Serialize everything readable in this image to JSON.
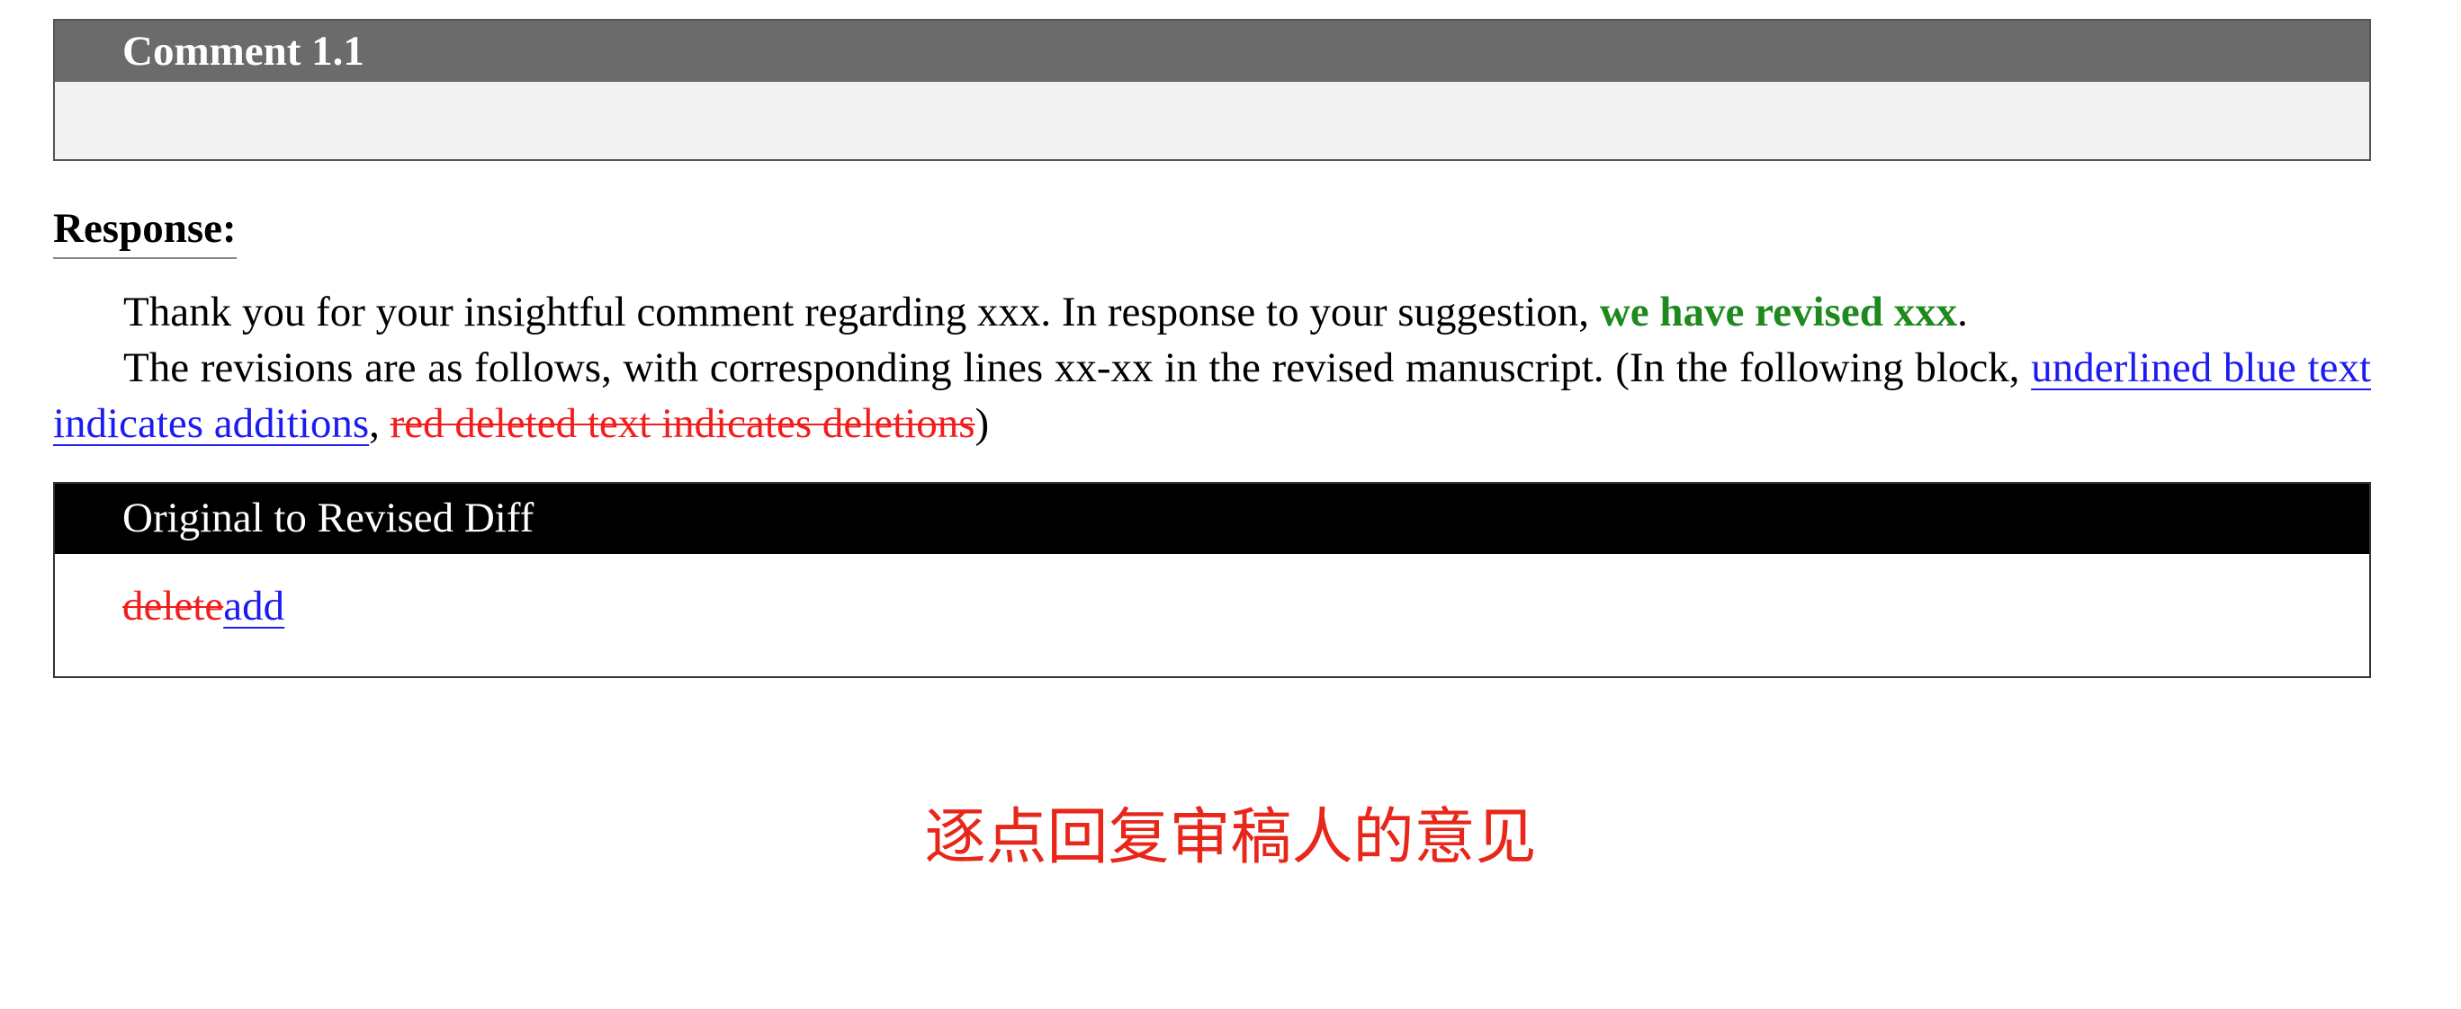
{
  "comment": {
    "title": "Comment 1.1",
    "body": ""
  },
  "response": {
    "label": "Response:",
    "line1_prefix": "Thank you for your insightful comment regarding xxx. In response to your suggestion, ",
    "line1_highlight": "we have revised xxx",
    "line1_suffix": ".",
    "line2_prefix": "The revisions are as follows, with corresponding lines xx-xx in the revised manuscript. (In the following block, ",
    "added_legend": "underlined blue text indicates additions",
    "separator": ", ",
    "deleted_legend": "red deleted text indicates deletions",
    "line2_suffix": ")"
  },
  "diff": {
    "title": "Original to Revised Diff",
    "deleted_text": "delete",
    "added_text": "add"
  },
  "caption": "逐点回复审稿人的意见",
  "colors": {
    "comment_header_bg": "#6b6b6b",
    "comment_body_bg": "#f2f2f2",
    "highlight_green": "#1e8a1e",
    "addition_blue": "#1c1cf0",
    "deletion_red": "#f21d1d",
    "diff_header_bg": "#000000",
    "caption_red": "#e8261a"
  }
}
